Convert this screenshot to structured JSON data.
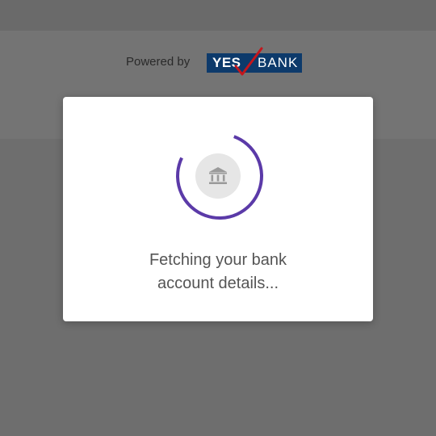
{
  "header": {
    "powered_by": "Powered by",
    "bank_logo_word1": "YES",
    "bank_logo_word2": "BANK"
  },
  "dialog": {
    "message_line1": "Fetching your bank",
    "message_line2": "account details..."
  },
  "colors": {
    "spinner_accent": "#5b3aa8",
    "logo_background": "#0d3a6b",
    "logo_tick": "#c4161c",
    "overlay": "#6e6e6e"
  },
  "icons": {
    "loading": "loading-spinner-icon",
    "bank": "bank-building-icon",
    "logo_tick": "tick-icon"
  }
}
